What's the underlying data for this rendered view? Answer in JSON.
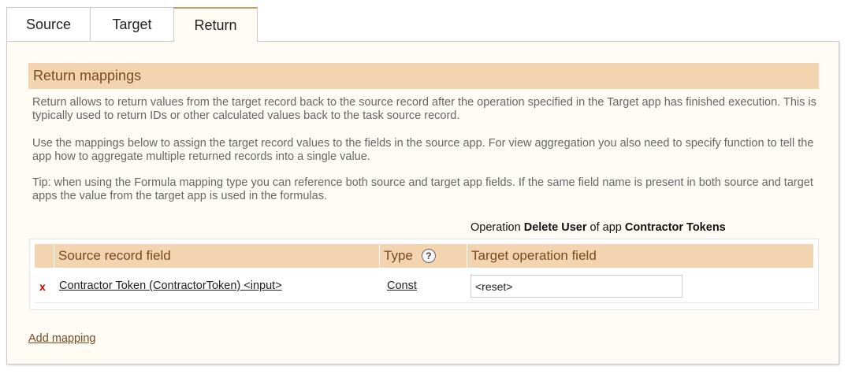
{
  "tabs": [
    {
      "label": "Source"
    },
    {
      "label": "Target"
    },
    {
      "label": "Return"
    }
  ],
  "section": {
    "title": "Return mappings",
    "descriptions": [
      "Return allows to return values from the target record back to the source record after the operation specified in the Target app has finished execution. This is typically used to return IDs or other calculated values back to the task source record.",
      "Use the mappings below to assign the target record values to the fields in the source app. For view aggregation you also need to specify function to tell the app how to aggregate multiple returned records into a single value.",
      "Tip: when using the Formula mapping type you can reference both source and target app fields. If the same field name is present in both source and target apps the value from the target app is used in the formulas."
    ]
  },
  "operation": {
    "prefix": "Operation",
    "name": "Delete User",
    "middle": "of app",
    "app": "Contractor Tokens"
  },
  "table": {
    "headers": {
      "source": "Source record field",
      "type": "Type",
      "target": "Target operation field"
    },
    "rows": [
      {
        "delete": "x",
        "source": "Contractor Token (ContractorToken) <input>",
        "type": "Const",
        "target": "<reset>"
      }
    ]
  },
  "add_mapping": "Add mapping",
  "help_glyph": "?"
}
